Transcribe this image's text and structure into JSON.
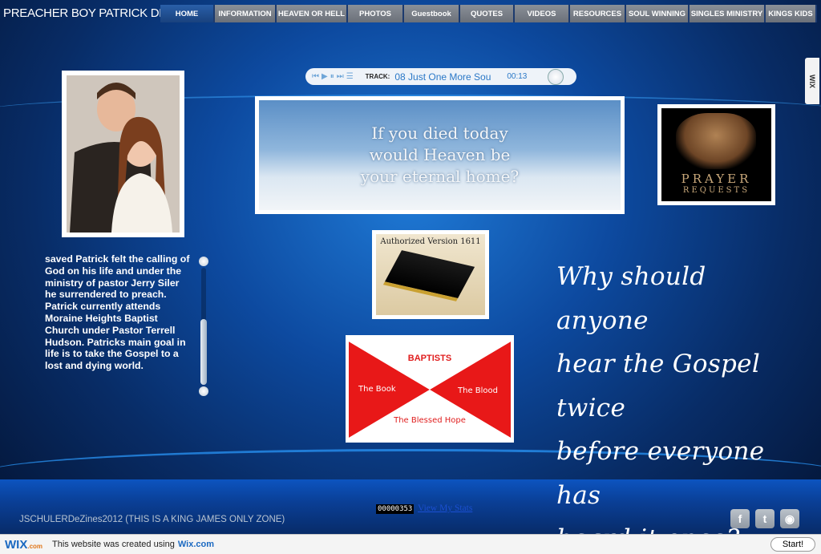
{
  "site": {
    "title": "PREACHER BOY PATRICK DELLARIA"
  },
  "nav": {
    "items": [
      {
        "label": "HOME",
        "active": true
      },
      {
        "label": "INFORMATION"
      },
      {
        "label": "HEAVEN OR HELL"
      },
      {
        "label": "PHOTOS"
      },
      {
        "label": "Guestbook"
      },
      {
        "label": "QUOTES"
      },
      {
        "label": "VIDEOS"
      },
      {
        "label": "RESOURCES"
      },
      {
        "label": "SOUL WINNING"
      },
      {
        "label": "SINGLES MINISTRY"
      },
      {
        "label": "KINGS KIDS"
      }
    ]
  },
  "player": {
    "track_label": "TRACK:",
    "track_name": "08 Just One More Sou",
    "time": "00:13",
    "controls": [
      "prev-icon",
      "play-icon",
      "pause-icon",
      "next-icon",
      "playlist-icon"
    ]
  },
  "banner": {
    "text": "If you died today\nwould Heaven be\nyour eternal home?"
  },
  "prayer": {
    "line1": "PRAYER",
    "line2": "REQUESTS"
  },
  "bible": {
    "title": "Authorized Version 1611"
  },
  "baptists": {
    "title": "BAPTISTS",
    "left": "The Book",
    "right": "The Blood",
    "bottom": "The Blessed Hope"
  },
  "story": {
    "text": "saved Patrick felt the calling of God on his life and under the ministry of pastor Jerry Siler he surrendered to preach. Patrick currently attends Moraine Heights Baptist Church under Pastor Terrell Hudson. Patricks main goal in life is to take the Gospel to a lost and dying world."
  },
  "quote": {
    "text": "Why should anyone\nhear the Gospel twice\nbefore everyone has\nheard it once?"
  },
  "wix_tab": {
    "label": "WIX"
  },
  "footer": {
    "credit": "JSCHULERDeZines2012 (THIS IS A KING JAMES ONLY ZONE)",
    "counter": "00000353",
    "stats_link": "View My Stats",
    "social": [
      {
        "icon": "facebook-icon",
        "glyph": "f"
      },
      {
        "icon": "twitter-icon",
        "glyph": "t"
      },
      {
        "icon": "rss-icon",
        "glyph": "◉"
      }
    ]
  },
  "wixbar": {
    "logo": "WIX",
    "logo_suffix": ".com",
    "message": "This website was created using",
    "link": "Wix.com",
    "start": "Start!"
  },
  "colors": {
    "nav_bg": "#7a8089",
    "nav_active": "#2a5fa8",
    "accent_blue": "#1b69c1",
    "baptist_red": "#e81818"
  }
}
